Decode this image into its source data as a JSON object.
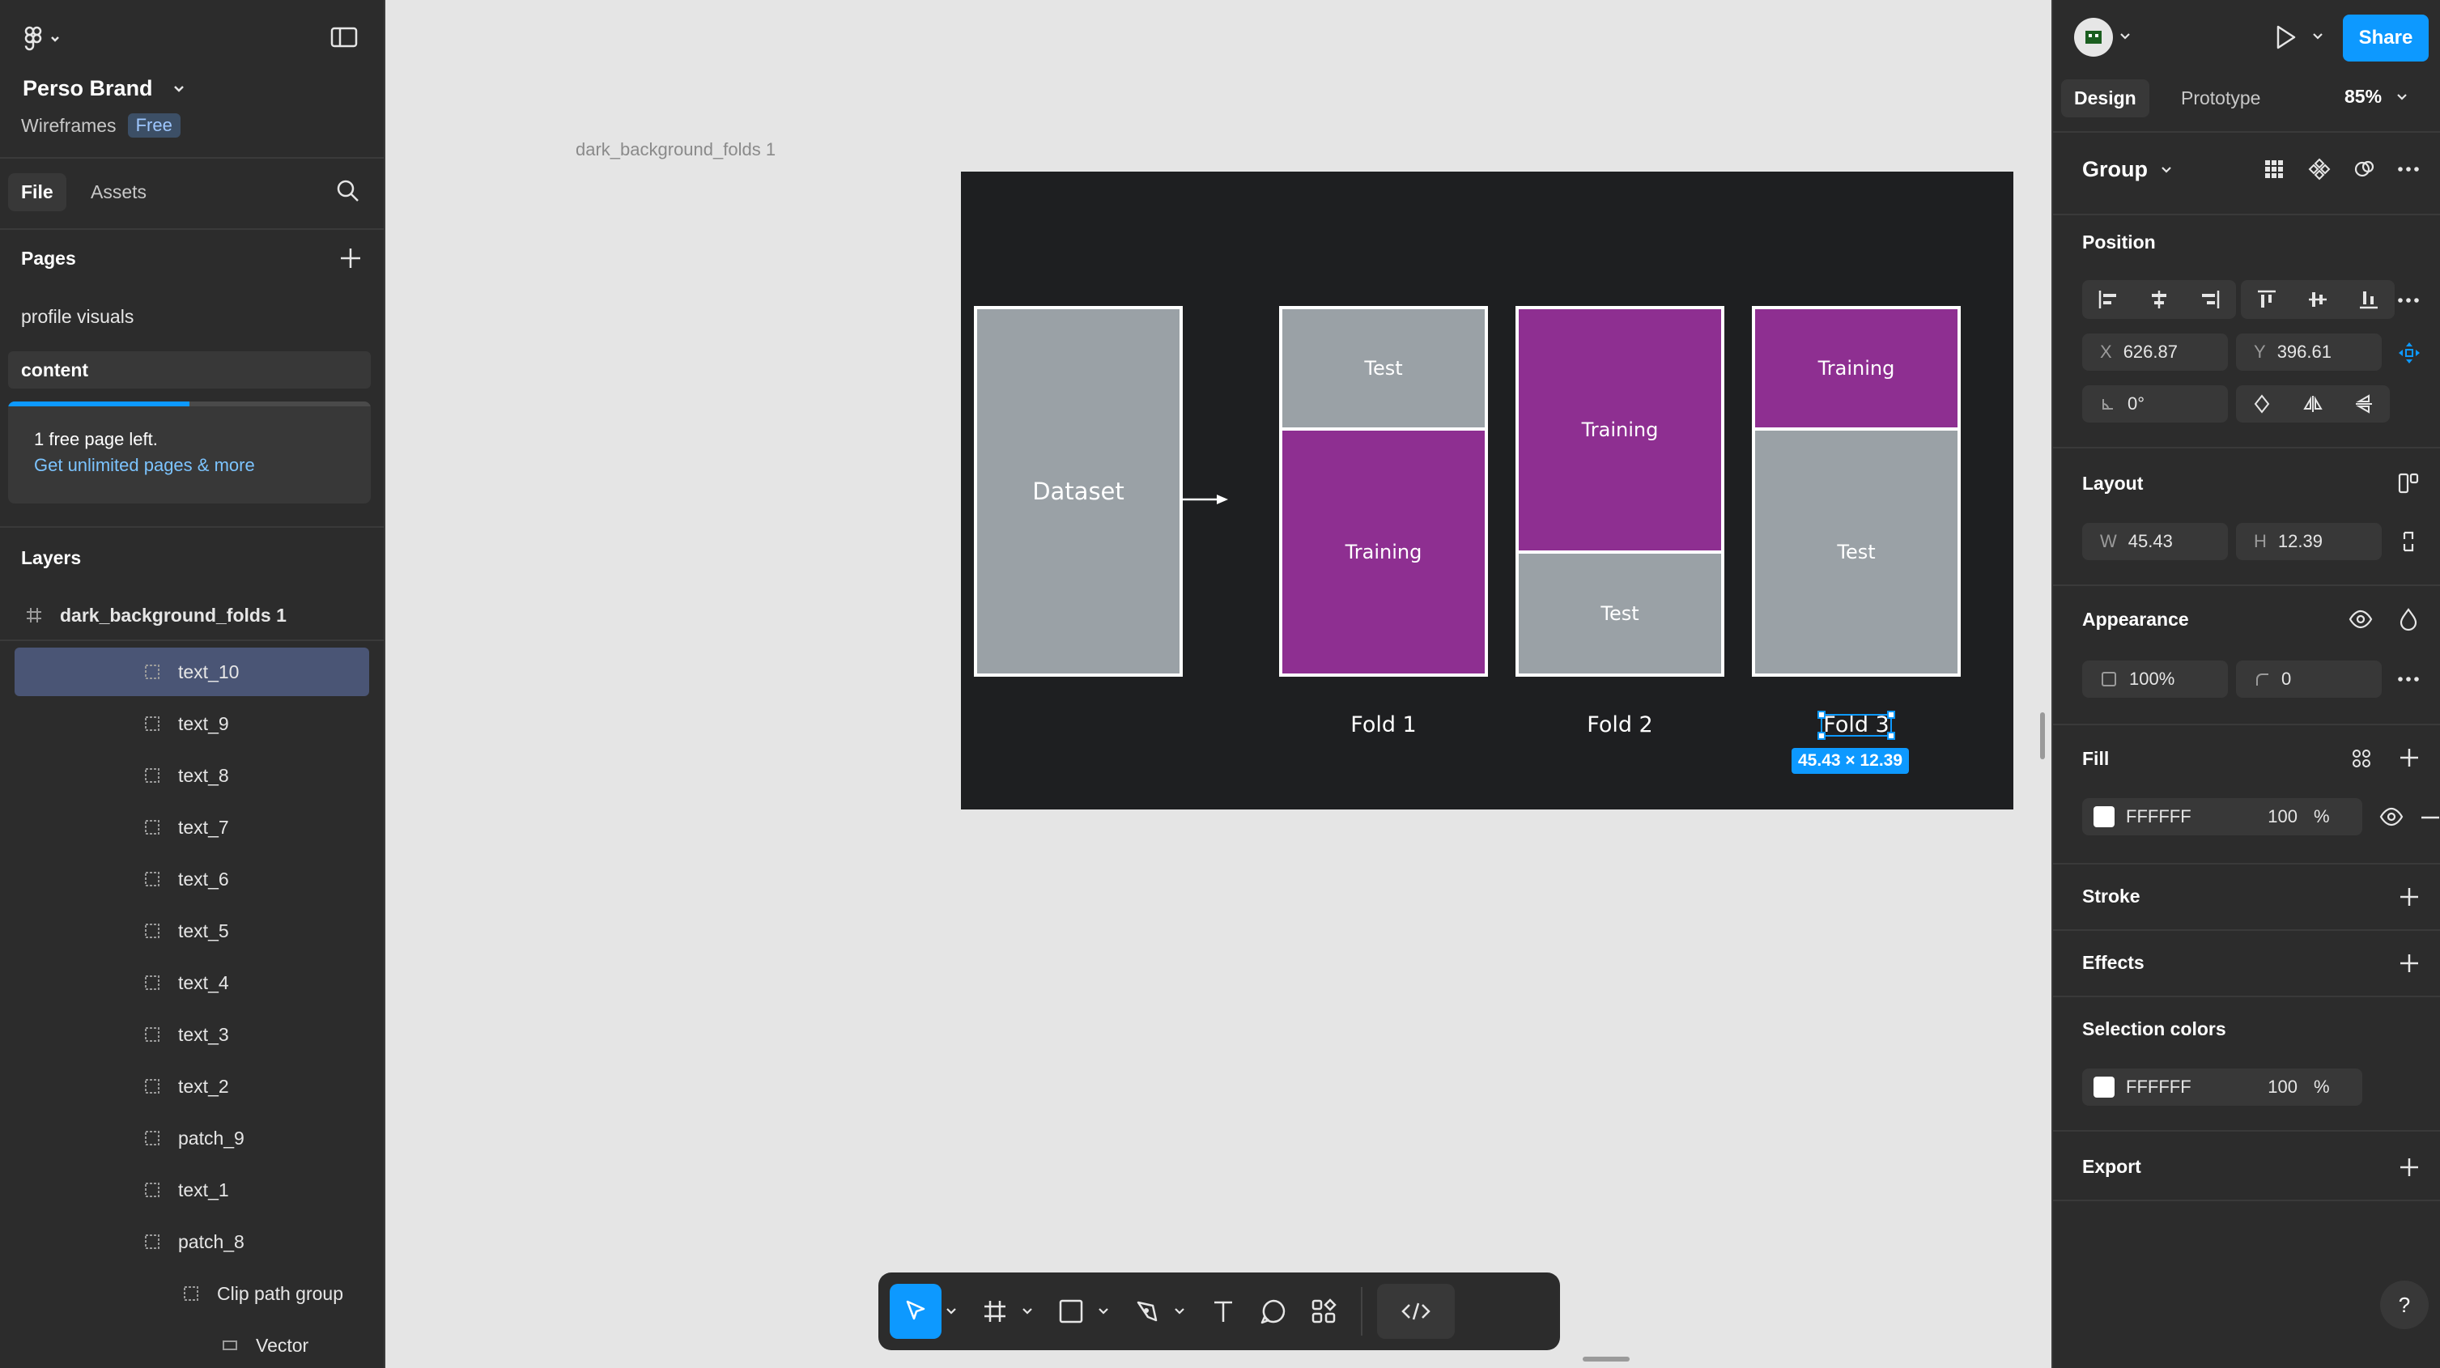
{
  "left_panel": {
    "project_name": "Perso Brand",
    "team_name": "Wireframes",
    "plan_badge": "Free",
    "tabs": [
      "File",
      "Assets"
    ],
    "pages_title": "Pages",
    "pages": [
      "profile visuals",
      "content"
    ],
    "upgrade": {
      "progress": 0.5,
      "text": "1 free page left.",
      "link": "Get unlimited pages & more"
    },
    "layers_title": "Layers",
    "root_layer": "dark_background_folds 1",
    "layers": [
      {
        "name": "text_10",
        "selected": true
      },
      {
        "name": "text_9"
      },
      {
        "name": "text_8"
      },
      {
        "name": "text_7"
      },
      {
        "name": "text_6"
      },
      {
        "name": "text_5"
      },
      {
        "name": "text_4"
      },
      {
        "name": "text_3"
      },
      {
        "name": "text_2"
      },
      {
        "name": "patch_9"
      },
      {
        "name": "text_1"
      },
      {
        "name": "patch_8"
      },
      {
        "name": "Clip path group"
      },
      {
        "name": "Vector"
      }
    ]
  },
  "canvas": {
    "frame_label": "dark_background_folds 1",
    "dataset_label": "Dataset",
    "folds": [
      {
        "top": "Test",
        "bottom": "Training",
        "label": "Fold 1"
      },
      {
        "top": "Training",
        "bottom": "Test",
        "label": "Fold 2"
      },
      {
        "top": "Training",
        "bottom": "Test",
        "label": "Fold 3"
      }
    ],
    "selection_size": "45.43 × 12.39"
  },
  "right_panel": {
    "tabs": [
      "Design",
      "Prototype"
    ],
    "zoom": "85%",
    "share_label": "Share",
    "selection_type": "Group",
    "position_title": "Position",
    "x_label": "X",
    "x_value": "626.87",
    "y_label": "Y",
    "y_value": "396.61",
    "rotation": "0°",
    "layout_title": "Layout",
    "w_label": "W",
    "w_value": "45.43",
    "h_label": "H",
    "h_value": "12.39",
    "appearance_title": "Appearance",
    "opacity": "100%",
    "radius": "0",
    "fill_title": "Fill",
    "fill_hex": "FFFFFF",
    "fill_opacity": "100",
    "percent": "%",
    "stroke_title": "Stroke",
    "effects_title": "Effects",
    "selection_colors_title": "Selection colors",
    "sel_hex": "FFFFFF",
    "sel_opacity": "100",
    "export_title": "Export",
    "help": "?"
  },
  "colors": {
    "accent": "#0d99ff",
    "purple_block": "#8e2f91",
    "gray_block": "#9aa1a6",
    "frame_bg": "#1e1f21"
  }
}
